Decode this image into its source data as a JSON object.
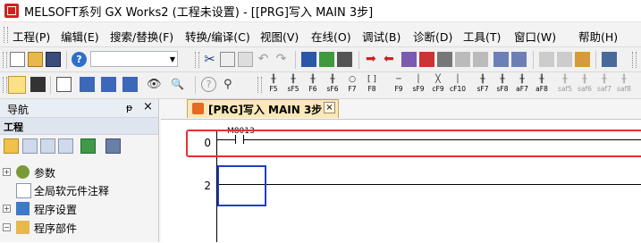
{
  "window": {
    "title": "MELSOFT系列 GX Works2 (工程未设置) - [[PRG]写入 MAIN 3步]"
  },
  "menu": [
    "工程(P)",
    "编辑(E)",
    "搜索/替换(F)",
    "转换/编译(C)",
    "视图(V)",
    "在线(O)",
    "调试(B)",
    "诊断(D)",
    "工具(T)",
    "窗口(W)",
    "帮助(H)"
  ],
  "toolbar2": {
    "fkeys": [
      {
        "sym": "╫",
        "label": "F5"
      },
      {
        "sym": "╫",
        "label": "sF5"
      },
      {
        "sym": "╫",
        "label": "F6"
      },
      {
        "sym": "╫",
        "label": "sF6"
      },
      {
        "sym": "○",
        "label": "F7"
      },
      {
        "sym": "[ ]",
        "label": "F8"
      },
      {
        "sym": "─",
        "label": "F9"
      },
      {
        "sym": "│",
        "label": "sF9"
      },
      {
        "sym": "╳",
        "label": "cF9"
      },
      {
        "sym": "│",
        "label": "cF10"
      },
      {
        "sym": "╫",
        "label": "sF7"
      },
      {
        "sym": "╫",
        "label": "sF8"
      },
      {
        "sym": "╫",
        "label": "aF7"
      },
      {
        "sym": "╫",
        "label": "aF8"
      },
      {
        "sym": "╫",
        "label": "saf5"
      },
      {
        "sym": "╫",
        "label": "saf6"
      },
      {
        "sym": "╫",
        "label": "saf7"
      },
      {
        "sym": "╫",
        "label": "saf8"
      }
    ]
  },
  "navigation": {
    "title": "导航",
    "pin": "ᵽ",
    "close": "×",
    "section": "工程",
    "tree": [
      {
        "label": "参数",
        "expander": "+"
      },
      {
        "label": "全局软元件注释",
        "expander": ""
      },
      {
        "label": "程序设置",
        "expander": "+"
      },
      {
        "label": "程序部件",
        "expander": "−"
      }
    ]
  },
  "editor": {
    "tab_label": "[PRG]写入 MAIN 3步",
    "tab_close": "×",
    "steps": [
      "0",
      "2"
    ],
    "contact_device": "M8013"
  },
  "colors": {
    "highlight_box": "#e4322b",
    "cursor": "#1f3fc2",
    "tab_bg": "#fbe8b8"
  }
}
